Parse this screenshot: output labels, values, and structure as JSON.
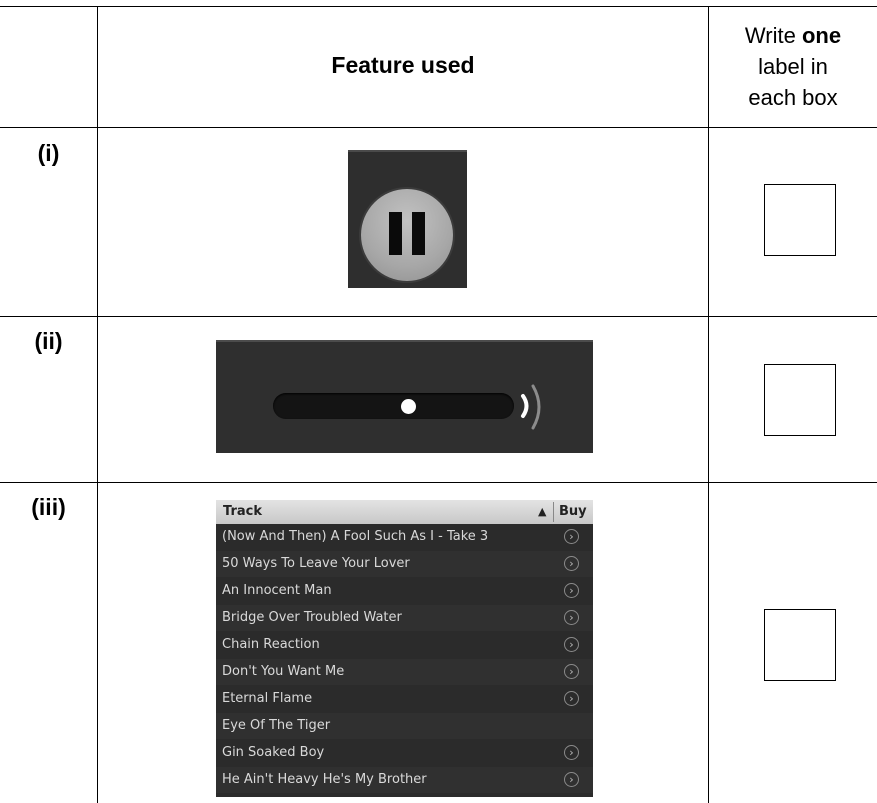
{
  "header": {
    "feature_label": "Feature used",
    "write_pre": "Write ",
    "write_bold": "one",
    "write_line2": "label in",
    "write_line3": "each box"
  },
  "rows": [
    {
      "label": "(i)"
    },
    {
      "label": "(ii)"
    },
    {
      "label": "(iii)"
    }
  ],
  "player": {
    "pause_icon": "pause-icon",
    "volume_level": 0.56,
    "volume_icon": "speaker-waves-icon"
  },
  "tracklist": {
    "col_track": "Track",
    "sort_glyph": "▲",
    "col_buy": "Buy",
    "buy_icon": "buy-arrow-icon",
    "tracks": [
      {
        "title": "(Now And Then) A Fool Such As I - Take 3",
        "buy": true
      },
      {
        "title": "50 Ways To Leave Your Lover",
        "buy": true
      },
      {
        "title": "An Innocent Man",
        "buy": true
      },
      {
        "title": "Bridge Over Troubled Water",
        "buy": true
      },
      {
        "title": "Chain Reaction",
        "buy": true
      },
      {
        "title": "Don't You Want Me",
        "buy": true
      },
      {
        "title": "Eternal Flame",
        "buy": true
      },
      {
        "title": "Eye Of The Tiger",
        "buy": false
      },
      {
        "title": "Gin Soaked Boy",
        "buy": true
      },
      {
        "title": "He Ain't Heavy He's My Brother",
        "buy": true
      }
    ]
  },
  "colors": {
    "panel_dark": "#2e2e2e",
    "header_light": "#d6d6d6",
    "text_light": "#d9d9d9"
  }
}
